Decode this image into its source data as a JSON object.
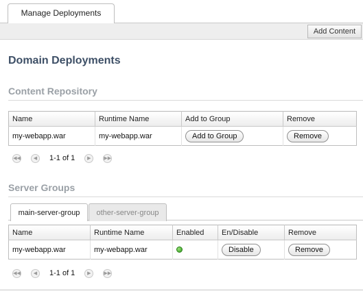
{
  "top_tab": {
    "label": "Manage Deployments"
  },
  "toolbar": {
    "add_content_label": "Add Content"
  },
  "page_title": "Domain Deployments",
  "content_repository": {
    "title": "Content Repository",
    "columns": [
      "Name",
      "Runtime Name",
      "Add to Group",
      "Remove"
    ],
    "rows": [
      {
        "name": "my-webapp.war",
        "runtime_name": "my-webapp.war",
        "add_label": "Add to Group",
        "remove_label": "Remove"
      }
    ],
    "pager_text": "1-1 of 1"
  },
  "server_groups": {
    "title": "Server Groups",
    "tabs": [
      {
        "label": "main-server-group",
        "active": true
      },
      {
        "label": "other-server-group",
        "active": false
      }
    ],
    "columns": [
      "Name",
      "Runtime Name",
      "Enabled",
      "En/Disable",
      "Remove"
    ],
    "rows": [
      {
        "name": "my-webapp.war",
        "runtime_name": "my-webapp.war",
        "enabled": true,
        "toggle_label": "Disable",
        "remove_label": "Remove"
      }
    ],
    "pager_text": "1-1 of 1"
  },
  "icons": {
    "first_page": "first-page-icon",
    "prev_page": "prev-page-icon",
    "next_page": "next-page-icon",
    "last_page": "last-page-icon",
    "enabled": "status-enabled-icon"
  },
  "colors": {
    "title": "#3d4f66",
    "section_title": "#9aa0a6",
    "enabled_green": "#2f9a1d"
  }
}
